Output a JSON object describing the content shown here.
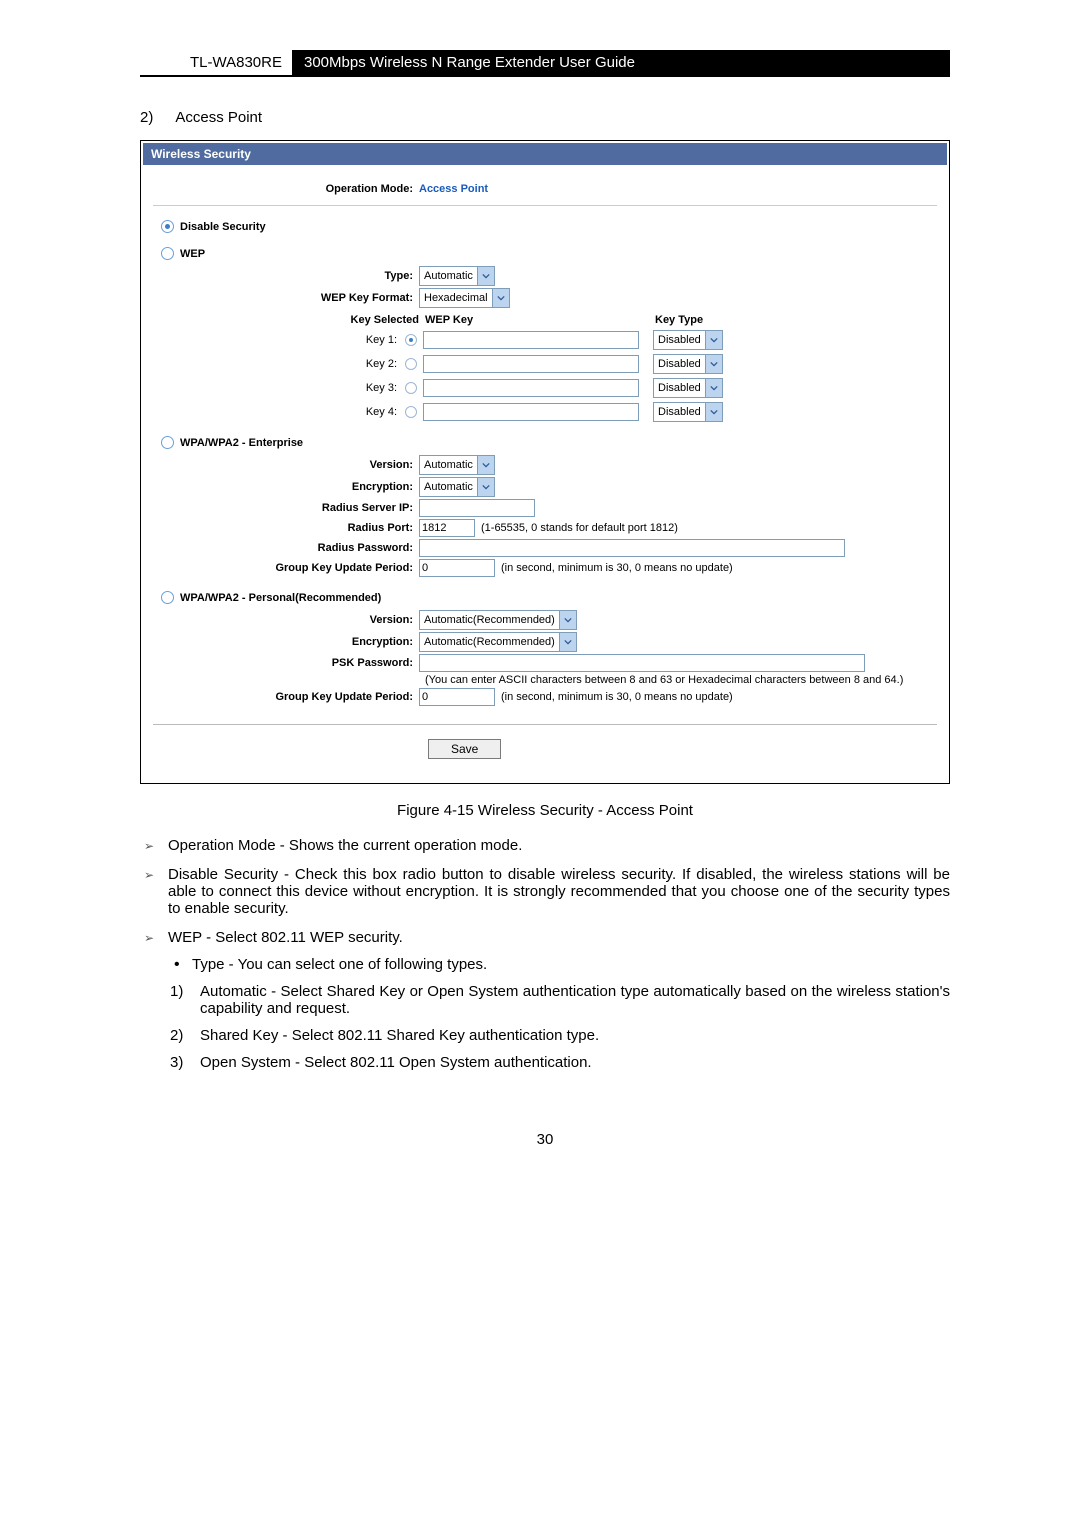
{
  "header": {
    "model": "TL-WA830RE",
    "title": "300Mbps Wireless N Range Extender User Guide"
  },
  "section": {
    "num": "2)",
    "title": "Access Point"
  },
  "panel": {
    "title": "Wireless Security",
    "op_mode_label": "Operation Mode:",
    "op_mode_value": "Access Point",
    "options": {
      "disable": {
        "label": "Disable Security"
      },
      "wep": {
        "label": "WEP",
        "type_label": "Type:",
        "type_value": "Automatic",
        "format_label": "WEP Key Format:",
        "format_value": "Hexadecimal",
        "col_selected": "Key Selected",
        "col_key": "WEP Key",
        "col_type": "Key Type",
        "keys": [
          {
            "name": "Key 1:",
            "type": "Disabled",
            "selected": true
          },
          {
            "name": "Key 2:",
            "type": "Disabled",
            "selected": false
          },
          {
            "name": "Key 3:",
            "type": "Disabled",
            "selected": false
          },
          {
            "name": "Key 4:",
            "type": "Disabled",
            "selected": false
          }
        ]
      },
      "enterprise": {
        "label": "WPA/WPA2 - Enterprise",
        "version_label": "Version:",
        "version_value": "Automatic",
        "encryption_label": "Encryption:",
        "encryption_value": "Automatic",
        "server_label": "Radius Server IP:",
        "port_label": "Radius Port:",
        "port_value": "1812",
        "port_hint": "(1-65535, 0 stands for default port 1812)",
        "password_label": "Radius Password:",
        "gkup_label": "Group Key Update Period:",
        "gkup_value": "0",
        "gkup_hint": "(in second, minimum is 30, 0 means no update)"
      },
      "personal": {
        "label": "WPA/WPA2 - Personal(Recommended)",
        "version_label": "Version:",
        "version_value": "Automatic(Recommended)",
        "encryption_label": "Encryption:",
        "encryption_value": "Automatic(Recommended)",
        "psk_label": "PSK Password:",
        "psk_hint": "(You can enter ASCII characters between 8 and 63 or Hexadecimal characters between 8 and 64.)",
        "gkup_label": "Group Key Update Period:",
        "gkup_value": "0",
        "gkup_hint": "(in second, minimum is 30, 0 means no update)"
      }
    },
    "save": "Save"
  },
  "caption": "Figure 4-15 Wireless Security - Access Point",
  "desc": {
    "op_mode": "Operation Mode  - Shows the current operation mode.",
    "disable": "Disable Security  - Check this box radio button to disable wireless security. If disabled, the wireless stations will be able to connect this device without encryption. It is strongly recommended that you choose one of the security types to enable security.",
    "wep": "WEP - Select 802.11 WEP security.",
    "type": "Type - You can select one of following types.",
    "auto_n": "1)",
    "auto": "Automatic  - Select Shared Key  or Open System  authentication type automatically based on the wireless station's capability and request.",
    "shared_n": "2)",
    "shared": "Shared Key - Select 802.11 Shared Key  authentication type.",
    "open_n": "3)",
    "open": "Open System  - Select 802.11 Open System  authentication."
  },
  "page_number": "30"
}
